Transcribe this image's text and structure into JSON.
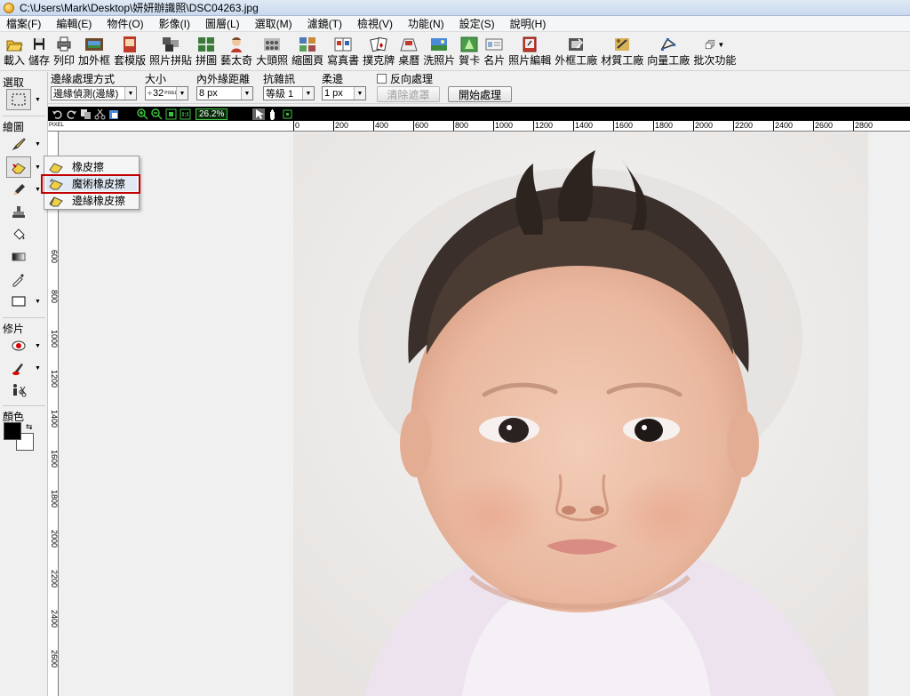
{
  "window": {
    "title": "C:\\Users\\Mark\\Desktop\\妍妍辦識照\\DSC04263.jpg"
  },
  "menu": [
    "檔案(F)",
    "編輯(E)",
    "物件(O)",
    "影像(I)",
    "圖層(L)",
    "選取(M)",
    "濾鏡(T)",
    "檢視(V)",
    "功能(N)",
    "設定(S)",
    "說明(H)"
  ],
  "toolbar": [
    {
      "label": "載入",
      "icon": "open-folder-icon"
    },
    {
      "label": "儲存",
      "icon": "save-disk-icon"
    },
    {
      "label": "列印",
      "icon": "printer-icon"
    },
    {
      "label": "加外框",
      "icon": "frame-icon"
    },
    {
      "label": "套模版",
      "icon": "template-icon"
    },
    {
      "label": "照片拼貼",
      "icon": "collage-icon"
    },
    {
      "label": "拼圖",
      "icon": "puzzle-icon"
    },
    {
      "label": "藝太奇",
      "icon": "artist-icon"
    },
    {
      "label": "大頭照",
      "icon": "id-photo-icon"
    },
    {
      "label": "縮圖頁",
      "icon": "thumbnail-page-icon"
    },
    {
      "label": "寫真書",
      "icon": "photo-book-icon"
    },
    {
      "label": "撲克牌",
      "icon": "poker-card-icon"
    },
    {
      "label": "桌曆",
      "icon": "desk-calendar-icon"
    },
    {
      "label": "洗照片",
      "icon": "print-photo-icon"
    },
    {
      "label": "賀卡",
      "icon": "greeting-card-icon"
    },
    {
      "label": "名片",
      "icon": "business-card-icon"
    },
    {
      "label": "照片編輯",
      "icon": "photo-edit-icon"
    },
    {
      "label": "外框工廠",
      "icon": "frame-factory-icon"
    },
    {
      "label": "材質工廠",
      "icon": "texture-factory-icon"
    },
    {
      "label": "向量工廠",
      "icon": "vector-factory-icon"
    },
    {
      "label": "批次功能",
      "icon": "batch-icon"
    }
  ],
  "options": {
    "edge_mode": {
      "label": "邊緣處理方式",
      "value": "邊緣偵測(邊緣)"
    },
    "size": {
      "label": "大小",
      "value": "32",
      "unit": "PIXEL"
    },
    "edge_distance": {
      "label": "內外緣距離",
      "value": "8 px"
    },
    "anti_noise": {
      "label": "抗雜訊",
      "value": "等級 1"
    },
    "feather": {
      "label": "柔邊",
      "value": "1 px"
    },
    "invert": {
      "label": "反向處理"
    },
    "clear_mask": "清除遮罩",
    "start": "開始處理"
  },
  "canvas_toolbar": {
    "zoom": "26.2%"
  },
  "ruler": {
    "unit": "PIXEL",
    "top_marks": [
      "0",
      "200",
      "400",
      "600",
      "800",
      "1000",
      "1200",
      "1400",
      "1600",
      "1800",
      "2000",
      "2200",
      "2400",
      "2600",
      "2800"
    ],
    "left_marks": [
      "600",
      "800",
      "1000",
      "1200",
      "1400",
      "1600",
      "1800",
      "2000",
      "2200",
      "2400",
      "2600"
    ]
  },
  "left_panel": {
    "select_label": "選取",
    "draw_label": "繪圖",
    "retouch_label": "修片",
    "color_label": "顏色"
  },
  "flyout": {
    "items": [
      "橡皮擦",
      "魔術橡皮擦",
      "邊緣橡皮擦"
    ],
    "highlighted": 1
  },
  "colors": {
    "highlight_box": "#c00000",
    "foreground": "#000000",
    "background": "#ffffff"
  }
}
